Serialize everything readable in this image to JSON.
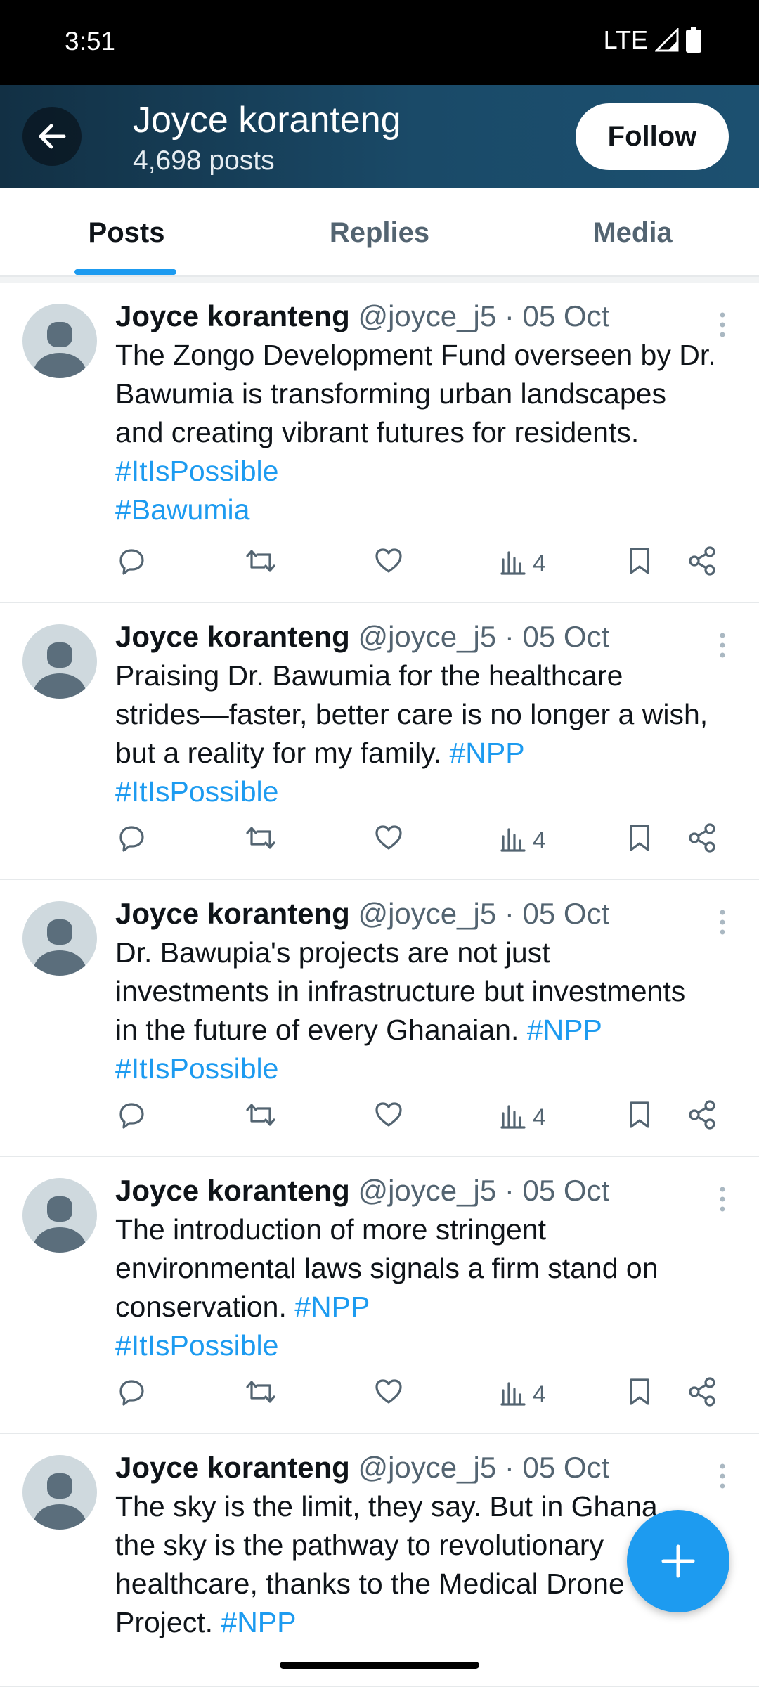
{
  "status_bar": {
    "time": "3:51",
    "network": "LTE"
  },
  "header": {
    "name": "Joyce koranteng",
    "post_count": "4,698 posts",
    "follow_label": "Follow"
  },
  "tabs": [
    {
      "label": "Posts",
      "active": true
    },
    {
      "label": "Replies",
      "active": false
    },
    {
      "label": "Media",
      "active": false
    }
  ],
  "posts": [
    {
      "name": "Joyce koranteng",
      "handle": "@joyce_j5",
      "date": "05 Oct",
      "lines": [
        {
          "text": "The Zongo Development Fund overseen by Dr.",
          "tag": ""
        },
        {
          "text": "Bawumia is transforming urban landscapes",
          "tag": ""
        },
        {
          "text": "and creating vibrant futures for residents.",
          "tag": ""
        },
        {
          "text": "",
          "tag": "#ItIsPossible"
        },
        {
          "text": "",
          "tag": "#Bawumia"
        }
      ],
      "views": "4"
    },
    {
      "name": "Joyce koranteng",
      "handle": "@joyce_j5",
      "date": "05 Oct",
      "lines": [
        {
          "text": "Praising Dr. Bawumia for the healthcare",
          "tag": ""
        },
        {
          "text": "strides—faster, better care is no longer a wish,",
          "tag": ""
        },
        {
          "text": "but a reality for my family. ",
          "tag": "#NPP"
        },
        {
          "text": "",
          "tag": "#ItIsPossible"
        }
      ],
      "views": "4"
    },
    {
      "name": "Joyce koranteng",
      "handle": "@joyce_j5",
      "date": "05 Oct",
      "lines": [
        {
          "text": "Dr. Bawupia's projects are not just",
          "tag": ""
        },
        {
          "text": "investments in infrastructure but investments",
          "tag": ""
        },
        {
          "text": "in the future of every Ghanaian. ",
          "tag": "#NPP"
        },
        {
          "text": "",
          "tag": "#ItIsPossible"
        }
      ],
      "views": "4"
    },
    {
      "name": "Joyce koranteng",
      "handle": "@joyce_j5",
      "date": "05 Oct",
      "lines": [
        {
          "text": "The introduction of more stringent",
          "tag": ""
        },
        {
          "text": "environmental laws signals a firm stand on",
          "tag": ""
        },
        {
          "text": "conservation. ",
          "tag": "#NPP"
        },
        {
          "text": "",
          "tag": "#ItIsPossible"
        }
      ],
      "views": "4"
    },
    {
      "name": "Joyce koranteng",
      "handle": "@joyce_j5",
      "date": "05 Oct",
      "lines": [
        {
          "text": "The sky is the limit, they say. But in Ghana",
          "tag": ""
        },
        {
          "text": "the sky is the pathway to revolutionary",
          "tag": ""
        },
        {
          "text": "healthcare, thanks to the Medical Drone",
          "tag": ""
        },
        {
          "text": "Project. ",
          "tag": "#NPP"
        }
      ],
      "views": ""
    }
  ],
  "colors": {
    "accent": "#1d9bf0",
    "header_bg": "#1a4a68",
    "meta_text": "#536471"
  }
}
